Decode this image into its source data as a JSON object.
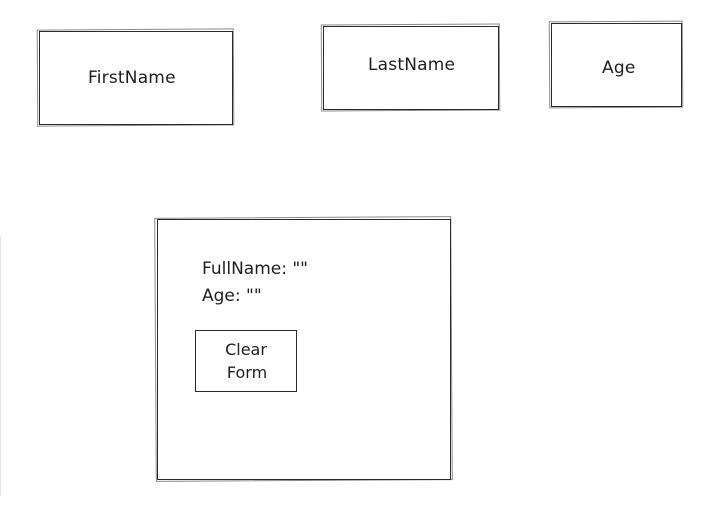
{
  "inputs": {
    "first_name": {
      "label": "FirstName"
    },
    "last_name": {
      "label": "LastName"
    },
    "age": {
      "label": "Age"
    }
  },
  "output": {
    "full_name_label": "FullName:",
    "full_name_value": "\"\"",
    "age_label": "Age:",
    "age_value": "\"\"",
    "clear_button": {
      "line1": "Clear",
      "line2": "Form"
    }
  }
}
